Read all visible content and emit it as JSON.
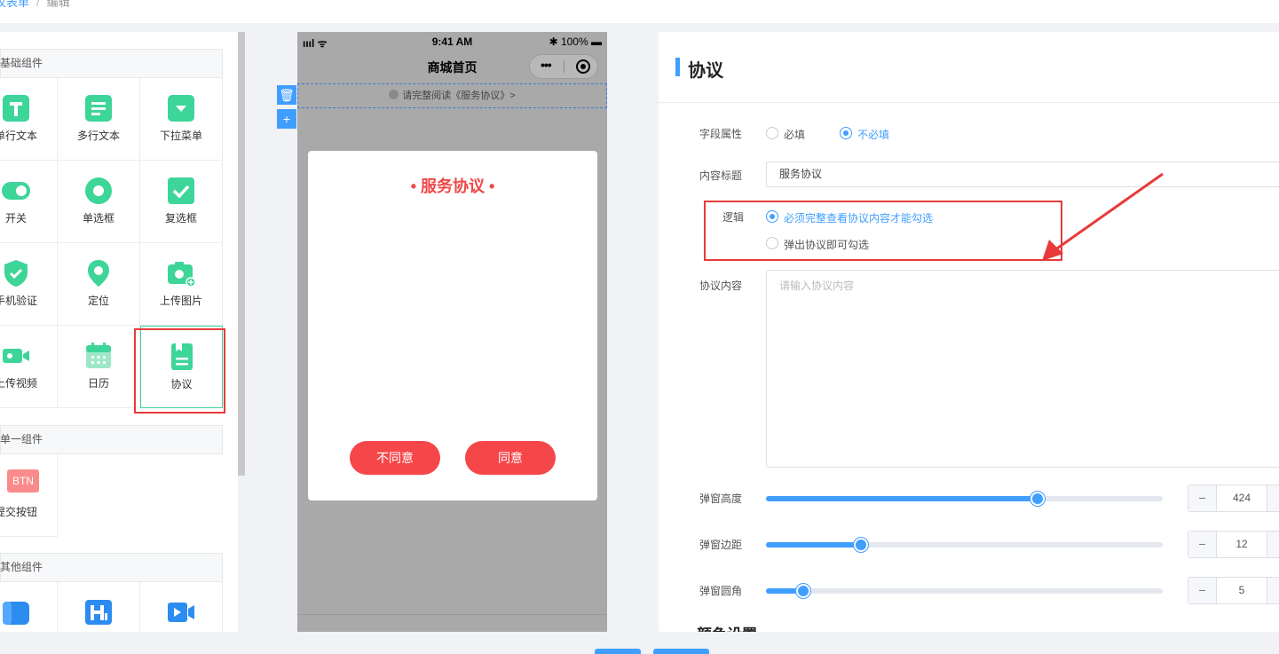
{
  "breadcrumb": {
    "parent": "议表单",
    "current": "编辑"
  },
  "components": {
    "groups": [
      {
        "title": "基础组件"
      },
      {
        "title": "单一组件"
      },
      {
        "title": "其他组件"
      }
    ],
    "basic": [
      {
        "label": "单行文本",
        "icon": "text-icon"
      },
      {
        "label": "多行文本",
        "icon": "multiline-text-icon"
      },
      {
        "label": "下拉菜单",
        "icon": "dropdown-icon"
      },
      {
        "label": "开关",
        "icon": "switch-icon"
      },
      {
        "label": "单选框",
        "icon": "radio-icon"
      },
      {
        "label": "复选框",
        "icon": "checkbox-icon"
      },
      {
        "label": "手机验证",
        "icon": "shield-check-icon"
      },
      {
        "label": "定位",
        "icon": "location-pin-icon"
      },
      {
        "label": "上传图片",
        "icon": "camera-icon"
      },
      {
        "label": "上传视频",
        "icon": "video-icon"
      },
      {
        "label": "日历",
        "icon": "calendar-icon"
      },
      {
        "label": "协议",
        "icon": "agreement-icon"
      }
    ],
    "single": [
      {
        "label": "提交按钮",
        "badge": "BTN",
        "icon": "btn-icon"
      }
    ],
    "other": [
      {
        "icon": "banner-icon"
      },
      {
        "icon": "heading-icon"
      },
      {
        "icon": "video-player-icon"
      }
    ]
  },
  "phone": {
    "time": "9:41 AM",
    "battery": "100%",
    "signal": "ıııl ᯤ",
    "nav_title": "商城首页",
    "agree_text": "请完整阅读《服务协议》>",
    "modal_title": "• 服务协议 •",
    "disagree": "不同意",
    "agree": "同意"
  },
  "props": {
    "title": "协议",
    "field_attr_label": "字段属性",
    "required": "必填",
    "not_required": "不必填",
    "content_title_label": "内容标题",
    "content_title_value": "服务协议",
    "logic_label": "逻辑",
    "logic_opt1": "必须完整查看协议内容才能勾选",
    "logic_opt2": "弹出协议即可勾选",
    "agreement_content_label": "协议内容",
    "agreement_placeholder": "请输入协议内容",
    "sliders": [
      {
        "label": "弹窗高度",
        "value": "424",
        "fraction": 0.685
      },
      {
        "label": "弹窗边距",
        "value": "12",
        "fraction": 0.24
      },
      {
        "label": "弹窗圆角",
        "value": "5",
        "fraction": 0.095
      }
    ],
    "next_section": "颜色设置"
  },
  "colors": {
    "accent": "#409eff",
    "brand_green": "#3dd598",
    "danger": "#f5474a",
    "highlight": "#e83a3a"
  }
}
